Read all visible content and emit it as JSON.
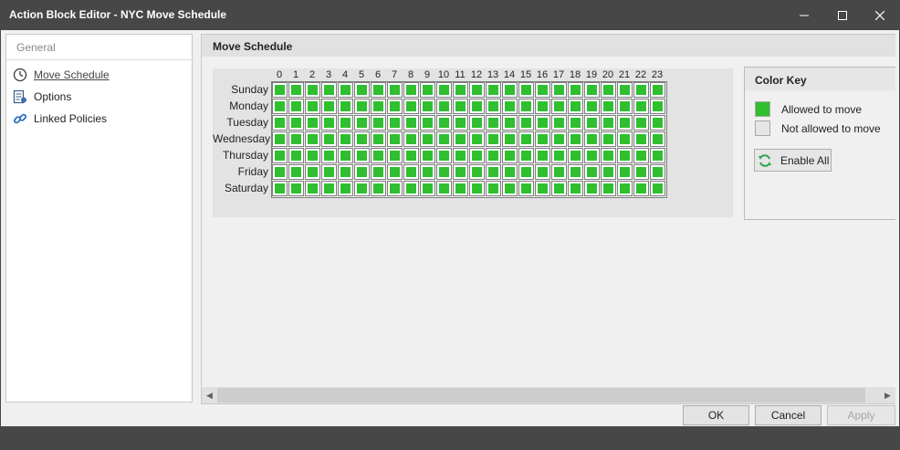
{
  "window": {
    "title": "Action Block Editor - NYC Move Schedule"
  },
  "sidebar": {
    "section": "General",
    "items": [
      {
        "label": "Move Schedule",
        "icon": "clock-icon",
        "active": true
      },
      {
        "label": "Options",
        "icon": "options-icon",
        "active": false
      },
      {
        "label": "Linked Policies",
        "icon": "link-icon",
        "active": false
      }
    ]
  },
  "main": {
    "header": "Move Schedule",
    "schedule": {
      "hours": [
        "0",
        "1",
        "2",
        "3",
        "4",
        "5",
        "6",
        "7",
        "8",
        "9",
        "10",
        "11",
        "12",
        "13",
        "14",
        "15",
        "16",
        "17",
        "18",
        "19",
        "20",
        "21",
        "22",
        "23"
      ],
      "days": [
        "Sunday",
        "Monday",
        "Tuesday",
        "Wednesday",
        "Thursday",
        "Friday",
        "Saturday"
      ],
      "allowed_all": true
    },
    "color_key": {
      "title": "Color Key",
      "allowed_label": "Allowed to move",
      "allowed_color": "#2fbf2f",
      "not_allowed_label": "Not allowed to move",
      "not_allowed_color": "#e6e6e6",
      "enable_all_label": "Enable All"
    }
  },
  "footer": {
    "ok_label": "OK",
    "cancel_label": "Cancel",
    "apply_label": "Apply"
  }
}
